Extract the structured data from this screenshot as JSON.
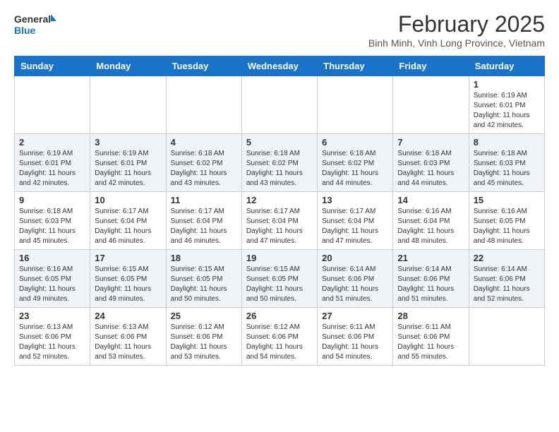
{
  "header": {
    "logo_line1": "General",
    "logo_line2": "Blue",
    "month_year": "February 2025",
    "location": "Binh Minh, Vinh Long Province, Vietnam"
  },
  "weekdays": [
    "Sunday",
    "Monday",
    "Tuesday",
    "Wednesday",
    "Thursday",
    "Friday",
    "Saturday"
  ],
  "weeks": [
    [
      {
        "day": "",
        "info": ""
      },
      {
        "day": "",
        "info": ""
      },
      {
        "day": "",
        "info": ""
      },
      {
        "day": "",
        "info": ""
      },
      {
        "day": "",
        "info": ""
      },
      {
        "day": "",
        "info": ""
      },
      {
        "day": "1",
        "info": "Sunrise: 6:19 AM\nSunset: 6:01 PM\nDaylight: 11 hours\nand 42 minutes."
      }
    ],
    [
      {
        "day": "2",
        "info": "Sunrise: 6:19 AM\nSunset: 6:01 PM\nDaylight: 11 hours\nand 42 minutes."
      },
      {
        "day": "3",
        "info": "Sunrise: 6:19 AM\nSunset: 6:01 PM\nDaylight: 11 hours\nand 42 minutes."
      },
      {
        "day": "4",
        "info": "Sunrise: 6:18 AM\nSunset: 6:02 PM\nDaylight: 11 hours\nand 43 minutes."
      },
      {
        "day": "5",
        "info": "Sunrise: 6:18 AM\nSunset: 6:02 PM\nDaylight: 11 hours\nand 43 minutes."
      },
      {
        "day": "6",
        "info": "Sunrise: 6:18 AM\nSunset: 6:02 PM\nDaylight: 11 hours\nand 44 minutes."
      },
      {
        "day": "7",
        "info": "Sunrise: 6:18 AM\nSunset: 6:03 PM\nDaylight: 11 hours\nand 44 minutes."
      },
      {
        "day": "8",
        "info": "Sunrise: 6:18 AM\nSunset: 6:03 PM\nDaylight: 11 hours\nand 45 minutes."
      }
    ],
    [
      {
        "day": "9",
        "info": "Sunrise: 6:18 AM\nSunset: 6:03 PM\nDaylight: 11 hours\nand 45 minutes."
      },
      {
        "day": "10",
        "info": "Sunrise: 6:17 AM\nSunset: 6:04 PM\nDaylight: 11 hours\nand 46 minutes."
      },
      {
        "day": "11",
        "info": "Sunrise: 6:17 AM\nSunset: 6:04 PM\nDaylight: 11 hours\nand 46 minutes."
      },
      {
        "day": "12",
        "info": "Sunrise: 6:17 AM\nSunset: 6:04 PM\nDaylight: 11 hours\nand 47 minutes."
      },
      {
        "day": "13",
        "info": "Sunrise: 6:17 AM\nSunset: 6:04 PM\nDaylight: 11 hours\nand 47 minutes."
      },
      {
        "day": "14",
        "info": "Sunrise: 6:16 AM\nSunset: 6:04 PM\nDaylight: 11 hours\nand 48 minutes."
      },
      {
        "day": "15",
        "info": "Sunrise: 6:16 AM\nSunset: 6:05 PM\nDaylight: 11 hours\nand 48 minutes."
      }
    ],
    [
      {
        "day": "16",
        "info": "Sunrise: 6:16 AM\nSunset: 6:05 PM\nDaylight: 11 hours\nand 49 minutes."
      },
      {
        "day": "17",
        "info": "Sunrise: 6:15 AM\nSunset: 6:05 PM\nDaylight: 11 hours\nand 49 minutes."
      },
      {
        "day": "18",
        "info": "Sunrise: 6:15 AM\nSunset: 6:05 PM\nDaylight: 11 hours\nand 50 minutes."
      },
      {
        "day": "19",
        "info": "Sunrise: 6:15 AM\nSunset: 6:05 PM\nDaylight: 11 hours\nand 50 minutes."
      },
      {
        "day": "20",
        "info": "Sunrise: 6:14 AM\nSunset: 6:06 PM\nDaylight: 11 hours\nand 51 minutes."
      },
      {
        "day": "21",
        "info": "Sunrise: 6:14 AM\nSunset: 6:06 PM\nDaylight: 11 hours\nand 51 minutes."
      },
      {
        "day": "22",
        "info": "Sunrise: 6:14 AM\nSunset: 6:06 PM\nDaylight: 11 hours\nand 52 minutes."
      }
    ],
    [
      {
        "day": "23",
        "info": "Sunrise: 6:13 AM\nSunset: 6:06 PM\nDaylight: 11 hours\nand 52 minutes."
      },
      {
        "day": "24",
        "info": "Sunrise: 6:13 AM\nSunset: 6:06 PM\nDaylight: 11 hours\nand 53 minutes."
      },
      {
        "day": "25",
        "info": "Sunrise: 6:12 AM\nSunset: 6:06 PM\nDaylight: 11 hours\nand 53 minutes."
      },
      {
        "day": "26",
        "info": "Sunrise: 6:12 AM\nSunset: 6:06 PM\nDaylight: 11 hours\nand 54 minutes."
      },
      {
        "day": "27",
        "info": "Sunrise: 6:11 AM\nSunset: 6:06 PM\nDaylight: 11 hours\nand 54 minutes."
      },
      {
        "day": "28",
        "info": "Sunrise: 6:11 AM\nSunset: 6:06 PM\nDaylight: 11 hours\nand 55 minutes."
      },
      {
        "day": "",
        "info": ""
      }
    ]
  ]
}
